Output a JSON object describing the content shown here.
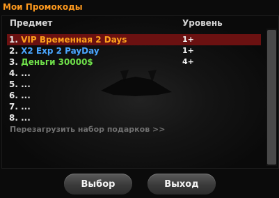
{
  "window": {
    "title": "Мои Промокоды"
  },
  "columns": {
    "item": "Предмет",
    "level": "Уровень"
  },
  "rows": [
    {
      "num": "1.",
      "label": "VIP Временная 2 Days",
      "level": "1+",
      "selected": true
    },
    {
      "num": "2.",
      "label": "X2 Exp 2 PayDay",
      "level": "1+"
    },
    {
      "num": "3.",
      "label": "Деньги 30000$",
      "level": "4+"
    },
    {
      "num": "4.",
      "label": "...",
      "level": ""
    },
    {
      "num": "5.",
      "label": "...",
      "level": ""
    },
    {
      "num": "6.",
      "label": "...",
      "level": ""
    },
    {
      "num": "7.",
      "label": "...",
      "level": ""
    },
    {
      "num": "8.",
      "label": "...",
      "level": ""
    }
  ],
  "reload_link": "Перезагрузить набор подарков >>",
  "buttons": {
    "select": "Выбор",
    "exit": "Выход"
  },
  "colors": {
    "title": "#ff9a1e",
    "selected_row": "#6b1111",
    "item_vip": "#ffa21c",
    "item_exp": "#4aa6ff",
    "item_money": "#6fe04a"
  }
}
